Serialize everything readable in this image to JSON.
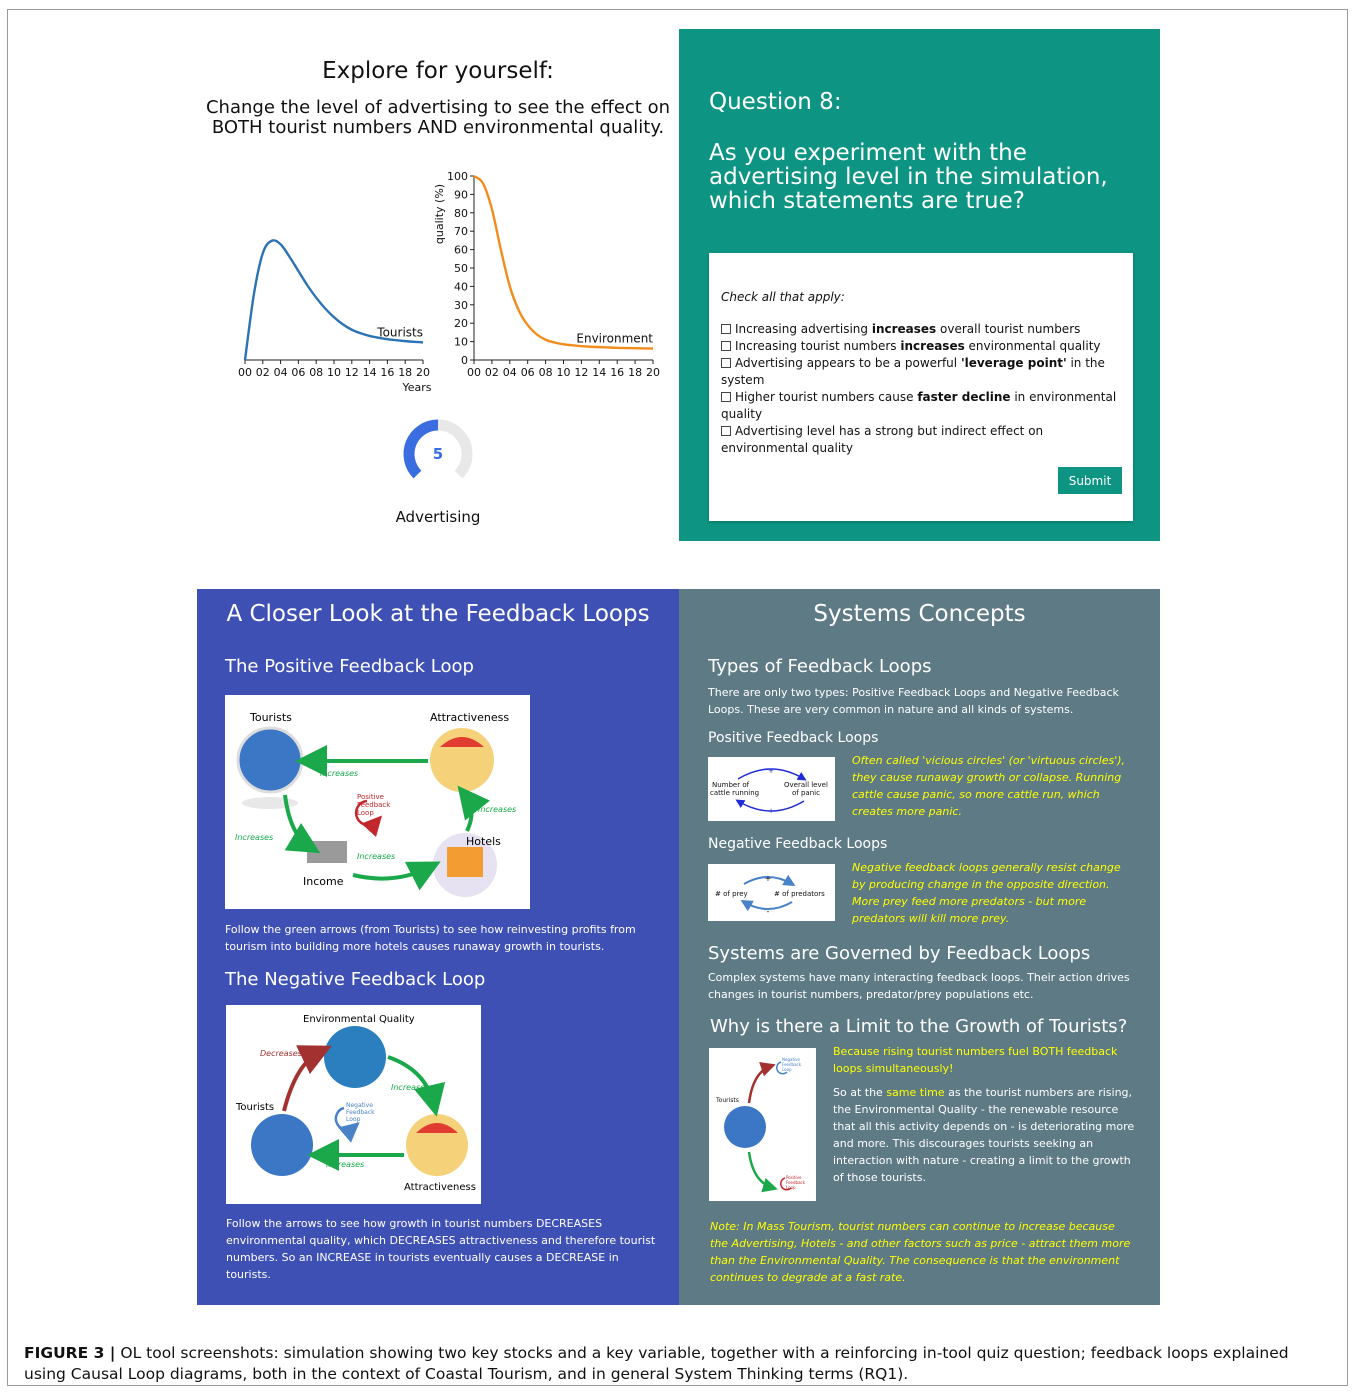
{
  "simulation": {
    "title": "Explore for yourself:",
    "subtitle": "Change the level of advertising to see the effect on BOTH tourist numbers AND environmental quality.",
    "gauge": {
      "value": "5",
      "label": "Advertising",
      "fraction": 0.5
    }
  },
  "chart_data": [
    {
      "type": "line",
      "series": [
        {
          "name": "Tourists",
          "color": "#2c73b3"
        }
      ],
      "x": [
        0,
        1,
        2,
        3,
        4,
        5,
        6,
        7,
        8,
        9,
        10,
        11,
        12,
        13,
        14,
        15,
        16,
        17,
        18,
        19,
        20
      ],
      "y": [
        0,
        37,
        60,
        67,
        65,
        58,
        50,
        42,
        35,
        29,
        24,
        20,
        17,
        15,
        13.5,
        12.5,
        11.7,
        11.1,
        10.6,
        10.2,
        9.9
      ],
      "xticks": [
        "00",
        "02",
        "04",
        "06",
        "08",
        "10",
        "12",
        "14",
        "16",
        "18",
        "20"
      ],
      "xlabel": "Years",
      "ylim": [
        0,
        100
      ]
    },
    {
      "type": "line",
      "series": [
        {
          "name": "Environment",
          "color": "#f28c1d"
        }
      ],
      "x": [
        0,
        1,
        2,
        3,
        4,
        5,
        6,
        7,
        8,
        9,
        10,
        11,
        12,
        13,
        14,
        15,
        16,
        17,
        18,
        19,
        20
      ],
      "y": [
        100,
        96,
        82,
        60,
        40,
        27,
        19,
        14,
        11,
        9.5,
        8.5,
        8,
        7.5,
        7.2,
        7,
        6.8,
        6.6,
        6.5,
        6.4,
        6.3,
        6.2
      ],
      "xticks": [
        "00",
        "02",
        "04",
        "06",
        "08",
        "10",
        "12",
        "14",
        "16",
        "18",
        "20"
      ],
      "yticks": [
        "0",
        "10",
        "20",
        "30",
        "40",
        "50",
        "60",
        "70",
        "80",
        "90",
        "100"
      ],
      "ylabel": "quality (%)",
      "ylim": [
        0,
        100
      ]
    }
  ],
  "question": {
    "title": "Question 8:",
    "text": "As you experiment with the advertising level in the simulation, which statements are true?",
    "hint": "Check all that apply:",
    "options": [
      {
        "pre": "Increasing advertising ",
        "bold": "increases",
        "post": " overall tourist numbers"
      },
      {
        "pre": "Increasing tourist numbers ",
        "bold": "increases",
        "post": " environmental quality"
      },
      {
        "pre": "Advertising appears to be a powerful ",
        "bold": "'leverage point'",
        "post": " in the system"
      },
      {
        "pre": "Higher tourist numbers cause ",
        "bold": "faster decline",
        "post": " in environmental quality"
      },
      {
        "pre": "Advertising level has a strong but indirect effect on environmental quality",
        "bold": "",
        "post": ""
      }
    ],
    "submit_label": "Submit"
  },
  "feedback": {
    "heading": "A Closer Look at the Feedback Loops",
    "positive_title": "The Positive Feedback Loop",
    "positive_diagram": {
      "tourists": "Tourists",
      "attractiveness": "Attractiveness",
      "hotels": "Hotels",
      "income": "Income",
      "increases": "Increases",
      "loop_l1": "Positive",
      "loop_l2": "Feedback",
      "loop_l3": "Loop"
    },
    "positive_text": "Follow the green arrows (from Tourists) to see how reinvesting profits from tourism into building more hotels causes runaway growth in tourists.",
    "negative_title": "The Negative Feedback Loop",
    "negative_diagram": {
      "env": "Environmental Quality",
      "tourists": "Tourists",
      "attractiveness": "Attractiveness",
      "decreases": "Decreases",
      "increases": "Increases",
      "loop_l1": "Negative",
      "loop_l2": "Feedback",
      "loop_l3": "Loop"
    },
    "negative_text": "Follow the arrows to see how growth in tourist numbers DECREASES environmental quality, which DECREASES attractiveness and therefore tourist numbers. So an INCREASE in tourists eventually causes a DECREASE in tourists."
  },
  "concepts": {
    "heading": "Systems Concepts",
    "types_title": "Types of Feedback Loops",
    "types_text": "There are only two types: Positive Feedback Loops and Negative Feedback Loops. These are very common in nature and all kinds of systems.",
    "pos_title": "Positive Feedback Loops",
    "pos_diagram": {
      "left_l1": "Number of",
      "left_l2": "cattle running",
      "right_l1": "Overall level",
      "right_l2": "of panic",
      "plus": "+"
    },
    "pos_text": "Often called 'vicious circles' (or 'virtuous circles'), they cause runaway growth or collapse. Running cattle cause panic, so more cattle run, which creates more panic.",
    "neg_title": "Negative Feedback Loops",
    "neg_diagram": {
      "left": "# of prey",
      "right": "# of predators",
      "plus": "+",
      "minus": "-"
    },
    "neg_text": "Negative feedback loops generally resist change by producing change in the opposite direction. More prey feed more predators - but more predators will kill more prey.",
    "governed_title": "Systems are Governed by Feedback Loops",
    "governed_text": "Complex systems have many interacting feedback loops. Their action drives changes in tourist numbers, predator/prey populations etc.",
    "limit_title": "Why is there a Limit to the Growth of Tourists?",
    "limit_diagram": {
      "tourists": "Tourists",
      "neg_l1": "Negative",
      "neg_l2": "Feedback",
      "neg_l3": "Loop",
      "pos_l1": "Positive",
      "pos_l2": "Feedback",
      "pos_l3": "Loop"
    },
    "limit_highlight": "Because rising tourist numbers fuel BOTH feedback loops simultaneously!",
    "limit_text_pre": "So at the ",
    "limit_text_highlight": "same time",
    "limit_text_post": " as the tourist numbers are rising, the Environmental Quality - the renewable resource that all this activity depends on - is deteriorating more and more. This discourages tourists seeking an interaction with nature - creating a limit to the growth of those tourists.",
    "note": "Note: In Mass Tourism, tourist numbers can continue to increase because the Advertising, Hotels - and other factors such as price - attract them more than the Environmental Quality. The consequence is that the environment continues to degrade at a fast rate."
  },
  "caption": {
    "label": "FIGURE 3 |",
    "text": " OL tool screenshots: simulation showing two key stocks and a key variable, together with a reinforcing in-tool quiz question; feedback loops explained using Causal Loop diagrams, both in the context of Coastal Tourism, and in general System Thinking terms (RQ1)."
  }
}
